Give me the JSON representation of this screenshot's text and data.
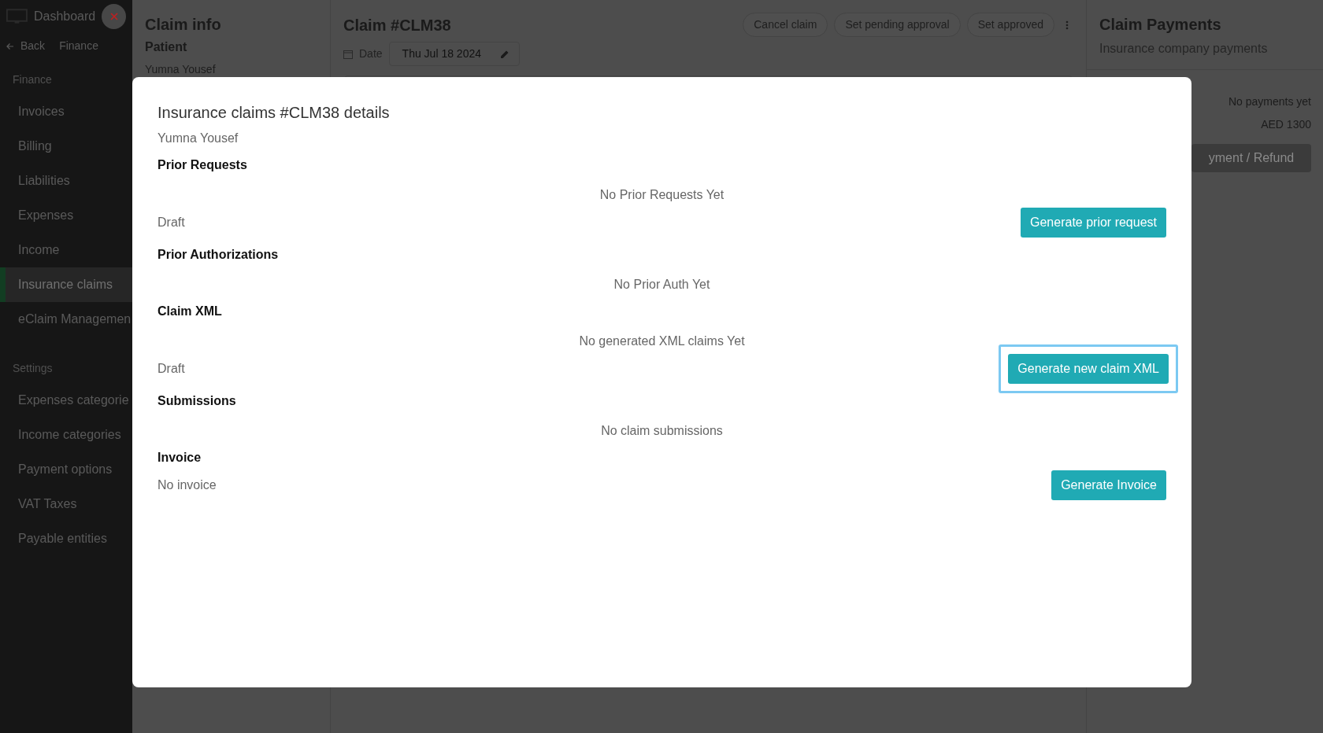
{
  "sidebar": {
    "title": "Dashboard",
    "breadcrumbs": [
      "Back",
      "Finance"
    ],
    "sections": [
      {
        "title": "Finance",
        "items": [
          {
            "label": "Invoices",
            "selected": false
          },
          {
            "label": "Billing",
            "selected": false
          },
          {
            "label": "Liabilities",
            "selected": false
          },
          {
            "label": "Expenses",
            "selected": false
          },
          {
            "label": "Income",
            "selected": false
          },
          {
            "label": "Insurance claims",
            "selected": true
          },
          {
            "label": "eClaim Managemen",
            "selected": false
          }
        ]
      },
      {
        "title": "Settings",
        "items": [
          {
            "label": "Expenses categorie",
            "selected": false
          },
          {
            "label": "Income categories",
            "selected": false
          },
          {
            "label": "Payment options",
            "selected": false
          },
          {
            "label": "VAT Taxes",
            "selected": false
          },
          {
            "label": "Payable entities",
            "selected": false
          }
        ]
      }
    ]
  },
  "claim_info": {
    "title": "Claim info",
    "patient_label": "Patient",
    "patient_name": "Yumna Yousef"
  },
  "claim": {
    "title": "Claim #CLM38",
    "actions": [
      "Cancel claim",
      "Set pending approval",
      "Set approved"
    ],
    "date_label": "Date",
    "date_value": "Thu Jul 18 2024"
  },
  "payments": {
    "title": "Claim Payments",
    "subtitle": "Insurance company payments",
    "status": "No payments yet",
    "amount": "AED 1300",
    "button": "yment / Refund"
  },
  "modal": {
    "title": "Insurance claims #CLM38 details",
    "subtitle": "Yumna Yousef",
    "sections": [
      {
        "heading": "Prior Requests",
        "empty_text": "No Prior Requests Yet",
        "rows": [
          {
            "label": "Draft",
            "action": {
              "label": "Generate prior request",
              "focused": false
            }
          }
        ]
      },
      {
        "heading": "Prior Authorizations",
        "empty_text": "No Prior Auth Yet"
      },
      {
        "heading": "Claim XML",
        "empty_text": "No generated XML claims Yet",
        "rows": [
          {
            "label": "Draft",
            "action": {
              "label": "Generate new claim XML",
              "focused": true
            }
          }
        ]
      },
      {
        "heading": "Submissions",
        "empty_text": "No claim submissions"
      },
      {
        "heading": "Invoice",
        "rows": [
          {
            "label": "No invoice",
            "action": {
              "label": "Generate Invoice",
              "focused": false
            }
          }
        ]
      }
    ]
  }
}
